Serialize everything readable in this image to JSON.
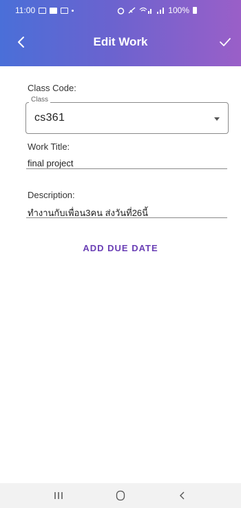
{
  "status_bar": {
    "time": "11:00",
    "battery": "100%",
    "signal_icons": [
      "gallery-icon",
      "photo-icon",
      "chat-icon",
      "alarm-icon",
      "mute-icon",
      "wifi-icon",
      "signal-icon"
    ]
  },
  "app_bar": {
    "title": "Edit Work",
    "back_icon": "chevron-left-icon",
    "confirm_icon": "check-icon"
  },
  "form": {
    "class_code_label": "Class Code:",
    "class_legend": "Class",
    "class_value": "cs361",
    "work_title_label": "Work Title:",
    "work_title_value": "final project",
    "description_label": "Description:",
    "description_value": "ทำงานกับเพื่อน3คน ส่งวันที่26นี้",
    "add_due_date": "ADD DUE DATE"
  },
  "nav_bar": {
    "items": [
      "recent-apps-icon",
      "home-icon",
      "back-icon"
    ]
  },
  "colors": {
    "header_gradient_start": "#4a6fd8",
    "header_gradient_end": "#9a5fc8",
    "accent": "#6a3fb5"
  }
}
